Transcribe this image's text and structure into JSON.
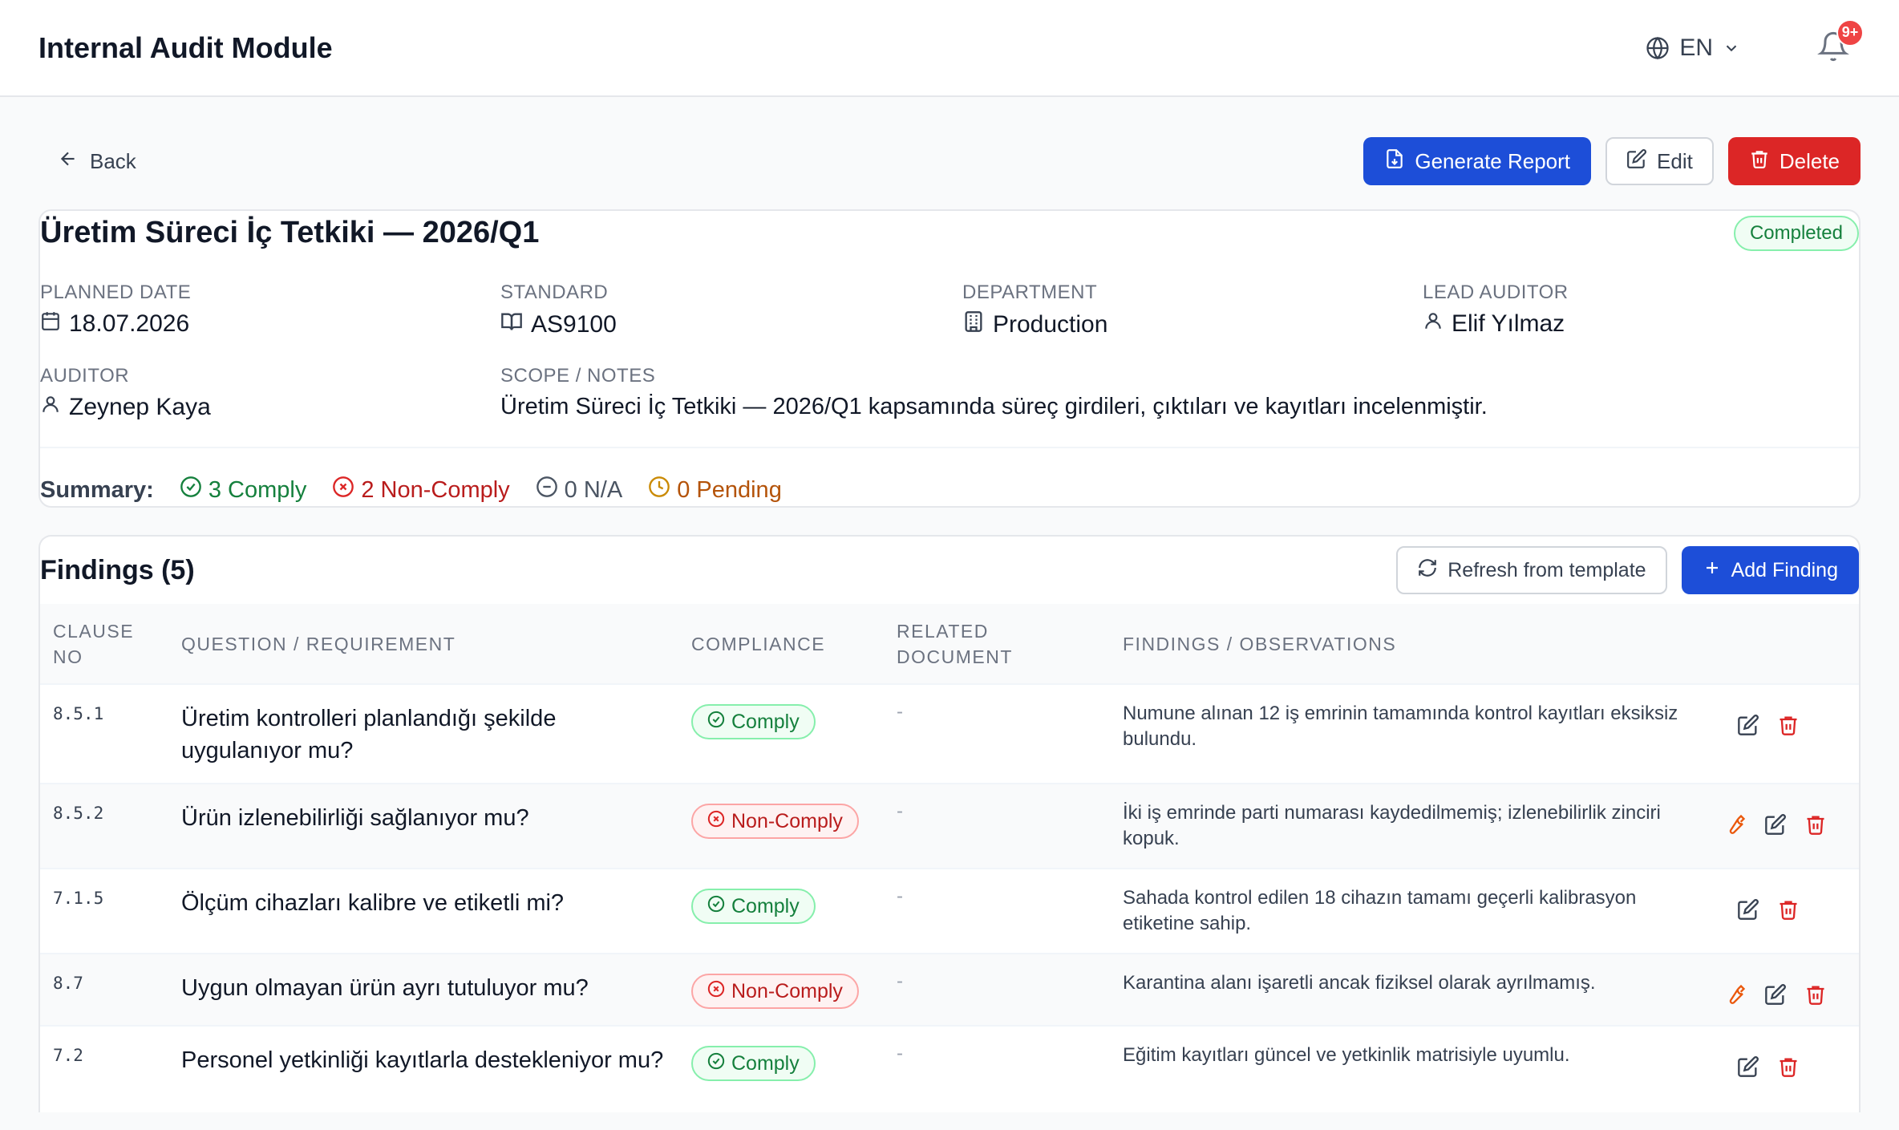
{
  "app": {
    "title": "Internal Audit Module"
  },
  "header": {
    "language": "EN",
    "notifications_badge": "9+"
  },
  "actions": {
    "back_label": "Back",
    "generate_report_label": "Generate Report",
    "edit_label": "Edit",
    "delete_label": "Delete"
  },
  "audit": {
    "title": "Üretim Süreci İç Tetkiki — 2026/Q1",
    "status": "Completed",
    "planned_date_label": "PLANNED DATE",
    "planned_date": "18.07.2026",
    "standard_label": "STANDARD",
    "standard": "AS9100",
    "department_label": "DEPARTMENT",
    "department": "Production",
    "lead_auditor_label": "LEAD AUDITOR",
    "lead_auditor": "Elif Yılmaz",
    "auditor_label": "AUDITOR",
    "auditor": "Zeynep Kaya",
    "scope_label": "SCOPE / NOTES",
    "scope": "Üretim Süreci İç Tetkiki — 2026/Q1 kapsamında süreç girdileri, çıktıları ve kayıtları incelenmiştir."
  },
  "summary": {
    "label": "Summary:",
    "comply": "3 Comply",
    "noncomply": "2 Non-Comply",
    "na": "0 N/A",
    "pending": "0 Pending"
  },
  "findings": {
    "title": "Findings (5)",
    "refresh_label": "Refresh from template",
    "add_label": "Add Finding",
    "columns": {
      "clause": "CLAUSE NO",
      "question": "QUESTION / REQUIREMENT",
      "compliance": "COMPLIANCE",
      "related": "RELATED DOCUMENT",
      "observations": "FINDINGS / OBSERVATIONS"
    },
    "rows": [
      {
        "clause": "8.5.1",
        "question": "Üretim kontrolleri planlandığı şekilde uygulanıyor mu?",
        "compliance": "Comply",
        "related": "-",
        "observation": "Numune alınan 12 iş emrinin tamamında kontrol kayıtları eksiksiz bulundu."
      },
      {
        "clause": "8.5.2",
        "question": "Ürün izlenebilirliği sağlanıyor mu?",
        "compliance": "Non-Comply",
        "related": "-",
        "observation": "İki iş emrinde parti numarası kaydedilmemiş; izlenebilirlik zinciri kopuk."
      },
      {
        "clause": "7.1.5",
        "question": "Ölçüm cihazları kalibre ve etiketli mi?",
        "compliance": "Comply",
        "related": "-",
        "observation": "Sahada kontrol edilen 18 cihazın tamamı geçerli kalibrasyon etiketine sahip."
      },
      {
        "clause": "8.7",
        "question": "Uygun olmayan ürün ayrı tutuluyor mu?",
        "compliance": "Non-Comply",
        "related": "-",
        "observation": "Karantina alanı işaretli ancak fiziksel olarak ayrılmamış."
      },
      {
        "clause": "7.2",
        "question": "Personel yetkinliği kayıtlarla destekleniyor mu?",
        "compliance": "Comply",
        "related": "-",
        "observation": "Eğitim kayıtları güncel ve yetkinlik matrisiyle uyumlu."
      }
    ]
  },
  "colors": {
    "primary": "#1d4ed8",
    "danger": "#dc2626",
    "comply": "#15803d",
    "noncomply": "#b91c1c",
    "pending": "#b45309",
    "fix": "#ea580c"
  }
}
